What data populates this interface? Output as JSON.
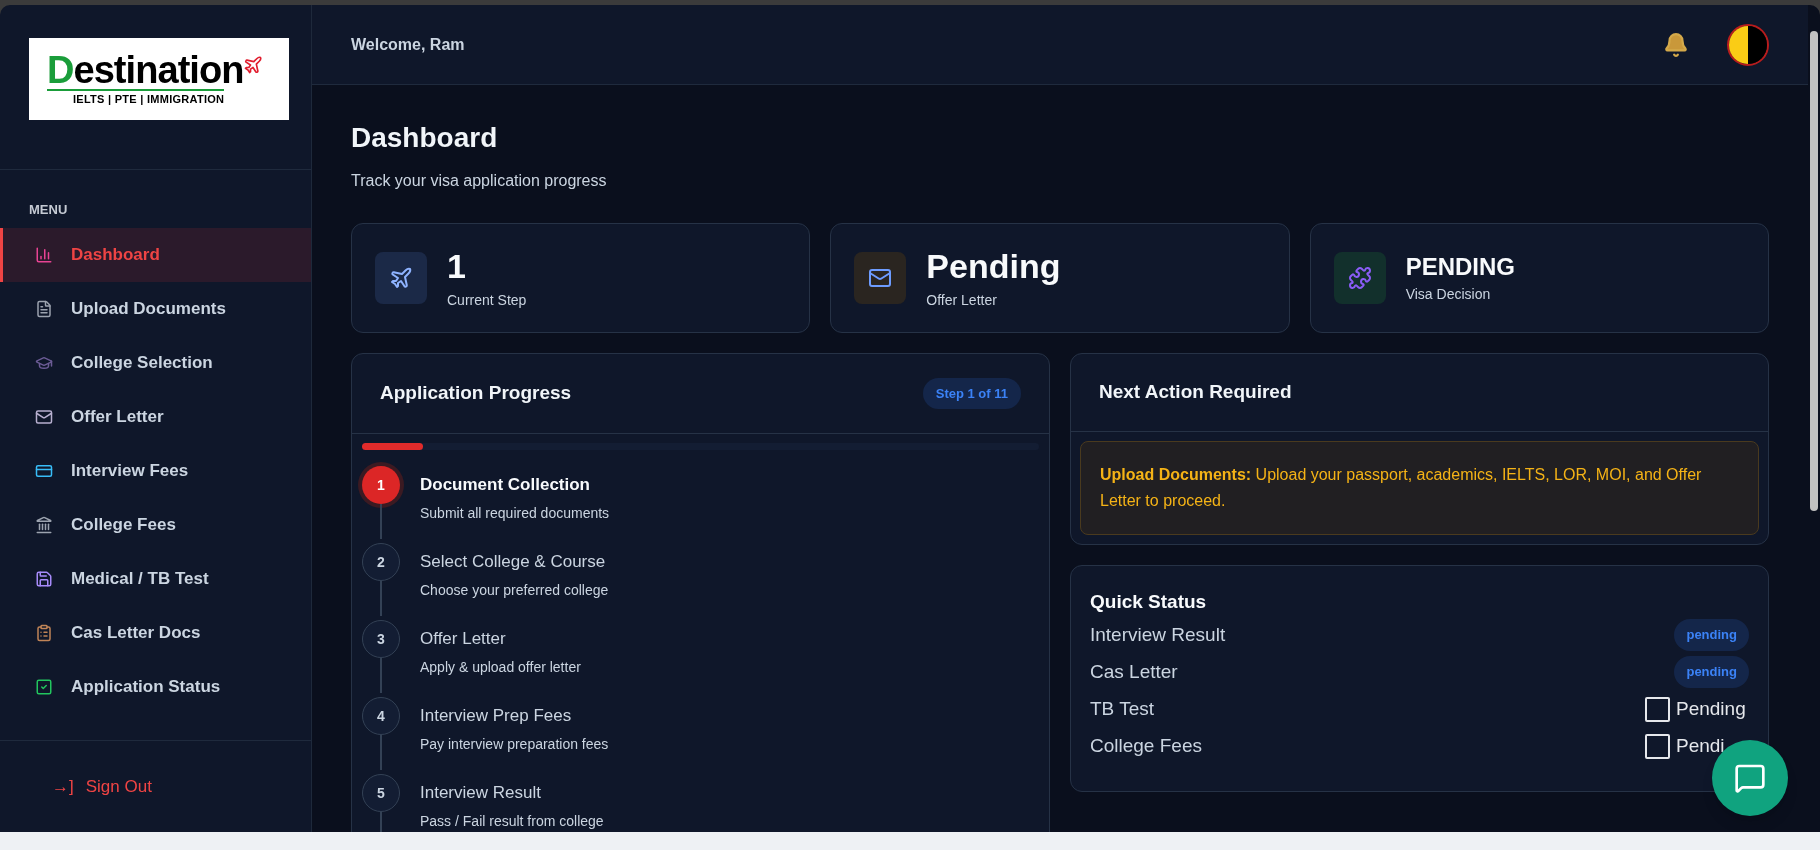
{
  "brand": {
    "name": "Destination",
    "tagline": "IELTS | PTE | IMMIGRATION"
  },
  "sidebar": {
    "heading": "MENU",
    "items": [
      {
        "label": "Dashboard",
        "selected": true
      },
      {
        "label": "Upload Documents",
        "selected": false
      },
      {
        "label": "College Selection",
        "selected": false
      },
      {
        "label": "Offer Letter",
        "selected": false
      },
      {
        "label": "Interview Fees",
        "selected": false
      },
      {
        "label": "College Fees",
        "selected": false
      },
      {
        "label": "Medical / TB Test",
        "selected": false
      },
      {
        "label": "Cas Letter Docs",
        "selected": false
      },
      {
        "label": "Application Status",
        "selected": false
      }
    ],
    "sign_out": {
      "icon": "→]",
      "label": "Sign Out"
    }
  },
  "header": {
    "welcome": "Welcome, Ram"
  },
  "page": {
    "title": "Dashboard",
    "subtitle": "Track your visa application progress"
  },
  "stats": [
    {
      "kind": "big",
      "value": "1",
      "label": "Current Step"
    },
    {
      "kind": "big",
      "value": "Pending",
      "label": "Offer Letter"
    },
    {
      "kind": "caps",
      "value": "PENDING",
      "label": "Visa Decision"
    }
  ],
  "progress": {
    "title": "Application Progress",
    "badge": "Step 1 of 11",
    "level": 0.09,
    "steps": [
      {
        "number": "1",
        "title": "Document Collection",
        "subtitle": "Submit all required documents",
        "selected": true
      },
      {
        "number": "2",
        "title": "Select College & Course",
        "subtitle": "Choose your preferred college",
        "selected": false
      },
      {
        "number": "3",
        "title": "Offer Letter",
        "subtitle": "Apply & upload offer letter",
        "selected": false
      },
      {
        "number": "4",
        "title": "Interview Prep Fees",
        "subtitle": "Pay interview preparation fees",
        "selected": false
      },
      {
        "number": "5",
        "title": "Interview Result",
        "subtitle": "Pass / Fail result from college",
        "selected": false
      }
    ]
  },
  "next_action": {
    "title": "Next Action Required",
    "message": "**Upload Documents:** Upload your passport, academics, IELTS, LOR, MOI, and Offer Letter to proceed."
  },
  "quick_status": {
    "title": "Quick Status",
    "rows": [
      {
        "kind": "badge",
        "label": "Interview Result",
        "status": "pending"
      },
      {
        "kind": "badge",
        "label": "Cas Letter",
        "status": "pending"
      },
      {
        "kind": "checkbox",
        "label": "TB Test",
        "status": "Pending",
        "checked": false
      },
      {
        "kind": "checkbox",
        "label": "College Fees",
        "status": "Pendi",
        "checked": false
      }
    ]
  }
}
